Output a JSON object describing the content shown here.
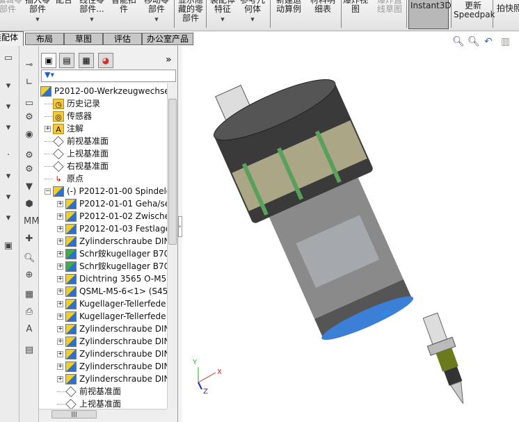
{
  "toolbar": {
    "items": [
      {
        "label": "编辑零\n部件",
        "disabled": true
      },
      {
        "label": "插入零\n部件",
        "dropdown": true
      },
      {
        "label": "配合"
      },
      {
        "label": "线性零\n部件...",
        "dropdown": true
      },
      {
        "label": "智能扣\n件"
      },
      {
        "label": "移动零\n部件",
        "dropdown": true
      },
      {
        "label": "显示隐\n藏的零\n部件"
      },
      {
        "label": "装配体\n特征",
        "dropdown": true
      },
      {
        "label": "参考几\n何体",
        "dropdown": true
      },
      {
        "label": "新建运\n动算例"
      },
      {
        "label": "材料明\n细表"
      },
      {
        "label": "爆炸视\n图"
      },
      {
        "label": "爆炸直\n线草图",
        "disabled": true
      },
      {
        "label": "Instant3D",
        "pressed": true
      },
      {
        "label": "更新\nSpeedpak"
      },
      {
        "label": "拍快照"
      }
    ]
  },
  "tabs": [
    {
      "label": "装配体",
      "active": true
    },
    {
      "label": "布局"
    },
    {
      "label": "草图"
    },
    {
      "label": "评估"
    },
    {
      "label": "办公室产品"
    }
  ],
  "feature_manager": {
    "expand_label": "»",
    "tree": [
      {
        "label": "P2012-00-Werkzeugwechse",
        "icon": "assembly-icon"
      },
      {
        "label": "历史记录",
        "icon": "history-folder-icon"
      },
      {
        "label": "传感器",
        "icon": "sensor-folder-icon"
      },
      {
        "label": "注解",
        "icon": "annotation-folder-icon",
        "expand": "+"
      },
      {
        "label": "前视基准面",
        "icon": "plane-icon"
      },
      {
        "label": "上视基准面",
        "icon": "plane-icon"
      },
      {
        "label": "右视基准面",
        "icon": "plane-icon"
      },
      {
        "label": "原点",
        "icon": "origin-icon"
      },
      {
        "label": "(-) P2012-01-00 Spindelg",
        "icon": "subassembly-icon",
        "expand": "−"
      },
      {
        "label": "P2012-01-01 Geha/se",
        "icon": "subassembly-icon",
        "expand": "+"
      },
      {
        "label": "P2012-01-02 Zwische",
        "icon": "subassembly-icon",
        "expand": "+"
      },
      {
        "label": "P2012-01-03 Festlage",
        "icon": "subassembly-icon",
        "expand": "+"
      },
      {
        "label": "Zylinderschraube DIN",
        "icon": "subassembly-icon",
        "expand": "+"
      },
      {
        "label": "Schr銨kugellager B70",
        "icon": "subassembly-green-icon",
        "expand": "+"
      },
      {
        "label": "Schr銨kugellager B70",
        "icon": "subassembly-green-icon",
        "expand": "+"
      },
      {
        "label": "Dichtring 3565 O-M5",
        "icon": "subassembly-icon",
        "expand": "+"
      },
      {
        "label": "QSML-M5-6<1> (S45",
        "icon": "subassembly-icon",
        "expand": "+"
      },
      {
        "label": "Kugellager-Tellerfede",
        "icon": "subassembly-icon",
        "expand": "+"
      },
      {
        "label": "Kugellager-Tellerfede",
        "icon": "subassembly-icon",
        "expand": "+"
      },
      {
        "label": "Zylinderschraube DIN",
        "icon": "subassembly-icon",
        "expand": "+"
      },
      {
        "label": "Zylinderschraube DIN",
        "icon": "subassembly-icon",
        "expand": "+"
      },
      {
        "label": "Zylinderschraube DIN",
        "icon": "subassembly-icon",
        "expand": "+"
      },
      {
        "label": "Zylinderschraube DIN",
        "icon": "subassembly-icon",
        "expand": "+"
      },
      {
        "label": "Zylinderschraube DIN",
        "icon": "subassembly-icon",
        "expand": "+"
      },
      {
        "label": "前视基准面",
        "icon": "plane-icon"
      },
      {
        "label": "上视基准面",
        "icon": "plane-icon"
      }
    ]
  },
  "triad": {
    "x": "X",
    "y": "Y",
    "z": "Z"
  }
}
